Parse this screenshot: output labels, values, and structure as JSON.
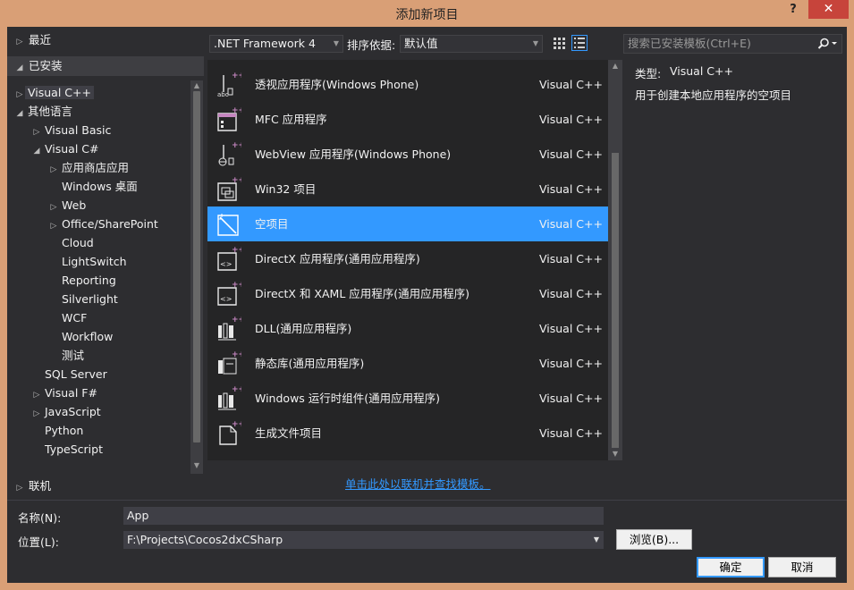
{
  "window": {
    "title": "添加新项目",
    "help": "?",
    "close": "✕"
  },
  "sidebar": {
    "recent": "最近",
    "installed": "已安装",
    "online": "联机",
    "tree": [
      {
        "label": "Visual C++",
        "indent": 0,
        "arrow": "▷",
        "selected": true
      },
      {
        "label": "其他语言",
        "indent": 0,
        "arrow": "◢"
      },
      {
        "label": "Visual Basic",
        "indent": 1,
        "arrow": "▷"
      },
      {
        "label": "Visual C#",
        "indent": 1,
        "arrow": "◢"
      },
      {
        "label": "应用商店应用",
        "indent": 2,
        "arrow": "▷"
      },
      {
        "label": "Windows 桌面",
        "indent": 2,
        "arrow": ""
      },
      {
        "label": "Web",
        "indent": 2,
        "arrow": "▷"
      },
      {
        "label": "Office/SharePoint",
        "indent": 2,
        "arrow": "▷"
      },
      {
        "label": "Cloud",
        "indent": 2,
        "arrow": ""
      },
      {
        "label": "LightSwitch",
        "indent": 2,
        "arrow": ""
      },
      {
        "label": "Reporting",
        "indent": 2,
        "arrow": ""
      },
      {
        "label": "Silverlight",
        "indent": 2,
        "arrow": ""
      },
      {
        "label": "WCF",
        "indent": 2,
        "arrow": ""
      },
      {
        "label": "Workflow",
        "indent": 2,
        "arrow": ""
      },
      {
        "label": "测试",
        "indent": 2,
        "arrow": ""
      },
      {
        "label": "SQL Server",
        "indent": 1,
        "arrow": ""
      },
      {
        "label": "Visual F#",
        "indent": 1,
        "arrow": "▷"
      },
      {
        "label": "JavaScript",
        "indent": 1,
        "arrow": "▷"
      },
      {
        "label": "Python",
        "indent": 1,
        "arrow": ""
      },
      {
        "label": "TypeScript",
        "indent": 1,
        "arrow": ""
      }
    ]
  },
  "toolbar": {
    "framework": ".NET Framework 4",
    "sort_label": "排序依据:",
    "sort_value": "默认值",
    "search_placeholder": "搜索已安装模板(Ctrl+E)"
  },
  "templates": [
    {
      "name": "透视应用程序(Windows Phone)",
      "lang": "Visual C++",
      "icon": "pivot-app-icon"
    },
    {
      "name": "MFC 应用程序",
      "lang": "Visual C++",
      "icon": "mfc-app-icon"
    },
    {
      "name": "WebView 应用程序(Windows Phone)",
      "lang": "Visual C++",
      "icon": "webview-app-icon"
    },
    {
      "name": "Win32 项目",
      "lang": "Visual C++",
      "icon": "win32-project-icon"
    },
    {
      "name": "空项目",
      "lang": "Visual C++",
      "icon": "empty-project-icon",
      "selected": true
    },
    {
      "name": "DirectX 应用程序(通用应用程序)",
      "lang": "Visual C++",
      "icon": "directx-app-icon"
    },
    {
      "name": "DirectX 和 XAML 应用程序(通用应用程序)",
      "lang": "Visual C++",
      "icon": "directx-xaml-app-icon"
    },
    {
      "name": "DLL(通用应用程序)",
      "lang": "Visual C++",
      "icon": "dll-icon"
    },
    {
      "name": "静态库(通用应用程序)",
      "lang": "Visual C++",
      "icon": "static-lib-icon"
    },
    {
      "name": "Windows 运行时组件(通用应用程序)",
      "lang": "Visual C++",
      "icon": "runtime-component-icon"
    },
    {
      "name": "生成文件项目",
      "lang": "Visual C++",
      "icon": "makefile-project-icon"
    }
  ],
  "details": {
    "type_label": "类型:",
    "type_value": "Visual C++",
    "description": "用于创建本地应用程序的空项目"
  },
  "online_link": "单击此处以联机并查找模板。",
  "form": {
    "name_label": "名称(N):",
    "name_value": "App",
    "location_label": "位置(L):",
    "location_value": "F:\\Projects\\Cocos2dxCSharp",
    "browse": "浏览(B)...",
    "ok": "确定",
    "cancel": "取消"
  },
  "colors": {
    "background": "#2d2d30",
    "accent": "#3399ff",
    "frame": "#d99f76"
  }
}
